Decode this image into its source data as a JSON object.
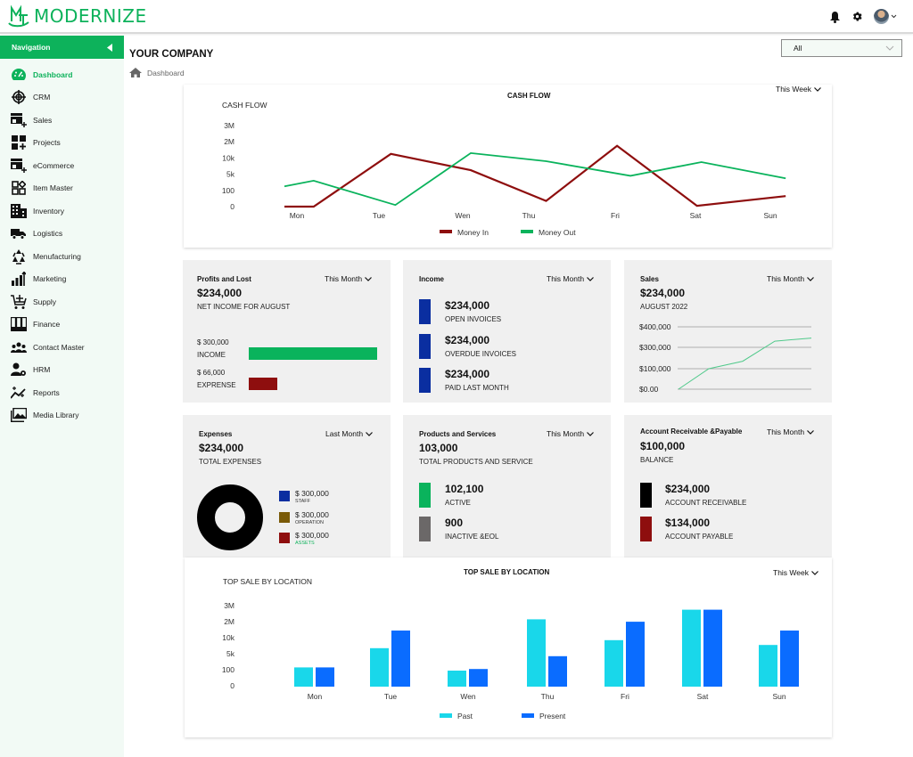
{
  "app": {
    "logo_text": "MODERNIZE",
    "brand_color": "#0db25b"
  },
  "topbar": {
    "icons": [
      "bell-icon",
      "gear-icon",
      "avatar"
    ]
  },
  "sidebar": {
    "header": "Navigation",
    "items": [
      {
        "label": "Dashboard",
        "icon": "dashboard-gauge-icon",
        "active": true
      },
      {
        "label": "CRM",
        "icon": "target-icon"
      },
      {
        "label": "Sales",
        "icon": "store-add-icon"
      },
      {
        "label": "Projects",
        "icon": "grid-add-icon"
      },
      {
        "label": "eCommerce",
        "icon": "store-add-icon"
      },
      {
        "label": "Item Master",
        "icon": "shapes-icon"
      },
      {
        "label": "Inventory",
        "icon": "building-icon"
      },
      {
        "label": "Logistics",
        "icon": "truck-icon"
      },
      {
        "label": "Menufacturing",
        "icon": "recycle-icon"
      },
      {
        "label": "Marketing",
        "icon": "bar-chart-up-icon"
      },
      {
        "label": "Supply",
        "icon": "cart-add-icon"
      },
      {
        "label": "Finance",
        "icon": "binders-icon"
      },
      {
        "label": "Contact Master",
        "icon": "group-icon"
      },
      {
        "label": "HRM",
        "icon": "user-gear-icon"
      },
      {
        "label": "Reports",
        "icon": "trend-sparkle-icon"
      },
      {
        "label": "Media Library",
        "icon": "images-icon"
      }
    ]
  },
  "page": {
    "title": "YOUR COMPANY",
    "breadcrumb": "Dashboard",
    "filter_value": "All"
  },
  "cash_flow": {
    "title": "CASH FLOW",
    "axis_title": "CASH FLOW",
    "period": "This Week"
  },
  "profit_loss": {
    "title": "Profits and Lost",
    "period": "This Month",
    "amount": "$234,000",
    "caption": "NET INCOME FOR AUGUST",
    "bars": [
      {
        "amount": "$ 300,000",
        "label": "INCOME",
        "value": 300000,
        "color": "#0ab35c"
      },
      {
        "amount": "$ 66,000",
        "label": "EXPRENSE",
        "value": 66000,
        "color": "#8e0e0e"
      }
    ]
  },
  "income": {
    "title": "Income",
    "period": "This Month",
    "items": [
      {
        "amount": "$234,000",
        "label": "OPEN INVOICES",
        "color": "#0a2ea0"
      },
      {
        "amount": "$234,000",
        "label": "OVERDUE INVOICES",
        "color": "#0a2ea0"
      },
      {
        "amount": "$234,000",
        "label": "PAID LAST MONTH",
        "color": "#0a2ea0"
      }
    ]
  },
  "sales": {
    "title": "Sales",
    "period": "This Month",
    "amount": "$234,000",
    "caption": "AUGUST 2022"
  },
  "expenses": {
    "title": "Expenses",
    "period": "Last Month",
    "amount": "$234,000",
    "caption": "TOTAL EXPENSES",
    "legend": [
      {
        "amount": "$ 300,000",
        "label": "STAFF",
        "color": "#0a2ea0",
        "label_color": "#333333"
      },
      {
        "amount": "$ 300,000",
        "label": "OPERATION",
        "color": "#7a5a08",
        "label_color": "#333333"
      },
      {
        "amount": "$ 300,000",
        "label": "ASSETS",
        "color": "#8e0e0e",
        "label_color": "#0db25b"
      }
    ]
  },
  "products": {
    "title": "Products and Services",
    "period": "This Month",
    "amount": "103,000",
    "caption": "TOTAL PRODUCTS AND SERVICE",
    "items": [
      {
        "amount": "102,100",
        "label": "ACTIVE",
        "color": "#0ab35c"
      },
      {
        "amount": "900",
        "label": "INACTIVE &EOL",
        "color": "#6b6868"
      }
    ]
  },
  "accounts": {
    "title": "Account Receivable &Payable",
    "period": "This Month",
    "amount": "$100,000",
    "caption": "BALANCE",
    "items": [
      {
        "amount": "$234,000",
        "label": "ACCOUNT RECEIVABLE",
        "color": "#000000"
      },
      {
        "amount": "$134,000",
        "label": "ACCOUNT PAYABLE",
        "color": "#8e0e0e"
      }
    ]
  },
  "top_sale": {
    "title": "TOP SALE BY LOCATION",
    "axis_title": "TOP SALE BY LOCATION",
    "period": "This Week"
  },
  "chart_data": [
    {
      "type": "line",
      "title": "CASH FLOW",
      "ylabel": "CASH FLOW",
      "categories": [
        "Mon",
        "Tue",
        "Wen",
        "Thu",
        "Fri",
        "Sat",
        "Sun"
      ],
      "y_tick_labels": [
        "0",
        "100",
        "5k",
        "10k",
        "2M",
        "3M"
      ],
      "y_scale_note": "values are positions on the categorical tick ladder (0=\"0\", 1=\"100\", 2=\"5k\", 3=\"10k\", 4=\"2M\", 5=\"3M\")",
      "x": [
        0,
        0.33,
        1.3,
        2.3,
        3.2,
        4.2,
        5.1,
        6.2
      ],
      "series": [
        {
          "name": "Money In",
          "color": "#8e0e0e",
          "x": [
            0,
            0.33,
            1.2,
            2.1,
            2.95,
            3.75,
            4.65,
            5.65
          ],
          "values": [
            0,
            0,
            3.25,
            2.25,
            0.35,
            3.75,
            0.05,
            0.65
          ]
        },
        {
          "name": "Money Out",
          "color": "#0ab35c",
          "x": [
            0,
            0.33,
            1.25,
            2.1,
            2.95,
            3.9,
            4.7,
            5.65
          ],
          "values": [
            1.25,
            1.6,
            0.1,
            3.3,
            2.8,
            1.9,
            2.75,
            1.75
          ]
        }
      ],
      "legend": "bottom",
      "grid": false
    },
    {
      "type": "line",
      "title": "Sales",
      "y_tick_labels": [
        "$0.00",
        "$100,000",
        "$300,000",
        "$400,000"
      ],
      "y_scale_note": "values are positions on the tick ladder (0=$0.00, 1=$100,000, 2=$300,000, 3=$400,000)",
      "x": [
        0,
        1,
        2,
        3,
        4
      ],
      "series": [
        {
          "name": "Sales",
          "color": "#4fc98a",
          "values": [
            0,
            1.0,
            1.35,
            2.3,
            2.45
          ]
        }
      ],
      "grid": true
    },
    {
      "type": "bar",
      "title": "TOP SALE BY LOCATION",
      "ylabel": "TOP SALE BY LOCATION",
      "categories": [
        "Mon",
        "Tue",
        "Wen",
        "Thu",
        "Fri",
        "Sat",
        "Sun"
      ],
      "y_tick_labels": [
        "0",
        "100",
        "5k",
        "10k",
        "2M",
        "3M"
      ],
      "y_scale_note": "values are positions on the categorical tick ladder (0=\"0\", 1=\"100\", 2=\"5k\", 3=\"10k\", 4=\"2M\", 5=\"3M\")",
      "series": [
        {
          "name": "Past",
          "color": "#19d7ea",
          "values": [
            1.2,
            2.4,
            1.0,
            4.2,
            2.9,
            4.8,
            2.6
          ]
        },
        {
          "name": "Present",
          "color": "#0a6cff",
          "values": [
            1.2,
            3.5,
            1.1,
            1.9,
            4.05,
            4.8,
            3.5
          ]
        }
      ],
      "legend": "bottom",
      "grid": false
    },
    {
      "type": "pie",
      "title": "Expenses",
      "donut": true,
      "slices": [
        {
          "label": "Total",
          "value": 1,
          "color": "#000000"
        }
      ]
    }
  ]
}
